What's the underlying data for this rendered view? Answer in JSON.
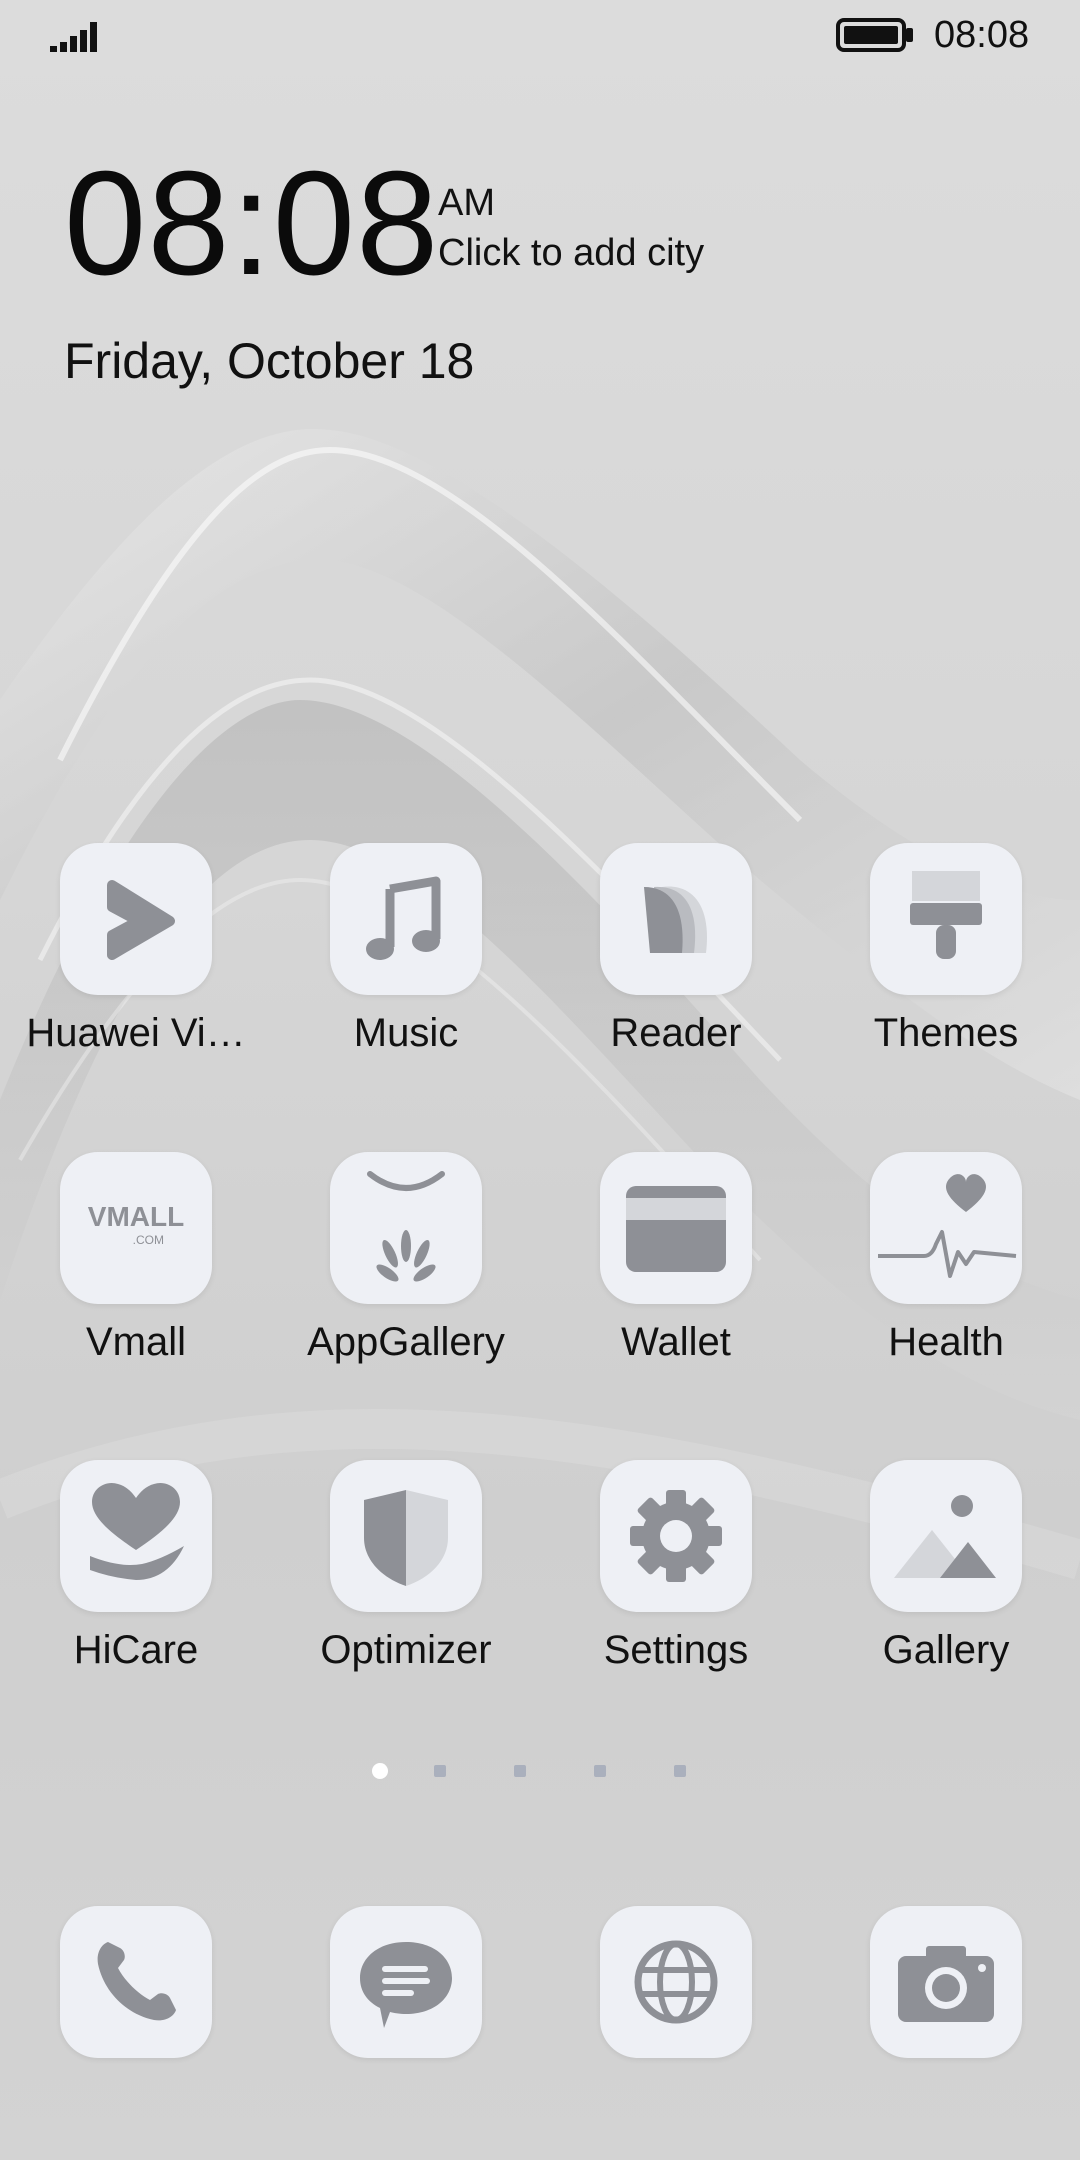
{
  "status_bar": {
    "time": "08:08",
    "signal_icon": "signal-icon",
    "battery_icon": "battery-icon"
  },
  "clock_widget": {
    "time": "08:08",
    "ampm": "AM",
    "city_prompt": "Click to add city",
    "date": "Friday, October 18"
  },
  "apps": [
    {
      "label": "Huawei Vi…",
      "icon": "huawei-video-icon"
    },
    {
      "label": "Music",
      "icon": "music-icon"
    },
    {
      "label": "Reader",
      "icon": "reader-icon"
    },
    {
      "label": "Themes",
      "icon": "themes-icon"
    },
    {
      "label": "Vmall",
      "icon": "vmall-icon",
      "icon_text": "VMALL",
      "icon_subtext": ".COM"
    },
    {
      "label": "AppGallery",
      "icon": "appgallery-icon"
    },
    {
      "label": "Wallet",
      "icon": "wallet-icon"
    },
    {
      "label": "Health",
      "icon": "health-icon"
    },
    {
      "label": "HiCare",
      "icon": "hicare-icon"
    },
    {
      "label": "Optimizer",
      "icon": "optimizer-icon"
    },
    {
      "label": "Settings",
      "icon": "settings-icon"
    },
    {
      "label": "Gallery",
      "icon": "gallery-icon"
    }
  ],
  "page_indicator": {
    "pages": 5,
    "current": 1
  },
  "dock": [
    {
      "icon": "phone-icon"
    },
    {
      "icon": "messages-icon"
    },
    {
      "icon": "browser-icon"
    },
    {
      "icon": "camera-icon"
    }
  ],
  "colors": {
    "icon_bg": "#eef0f5",
    "glyph": "#8e9096",
    "glyph_light": "#b9bbc0",
    "text": "#111111"
  }
}
